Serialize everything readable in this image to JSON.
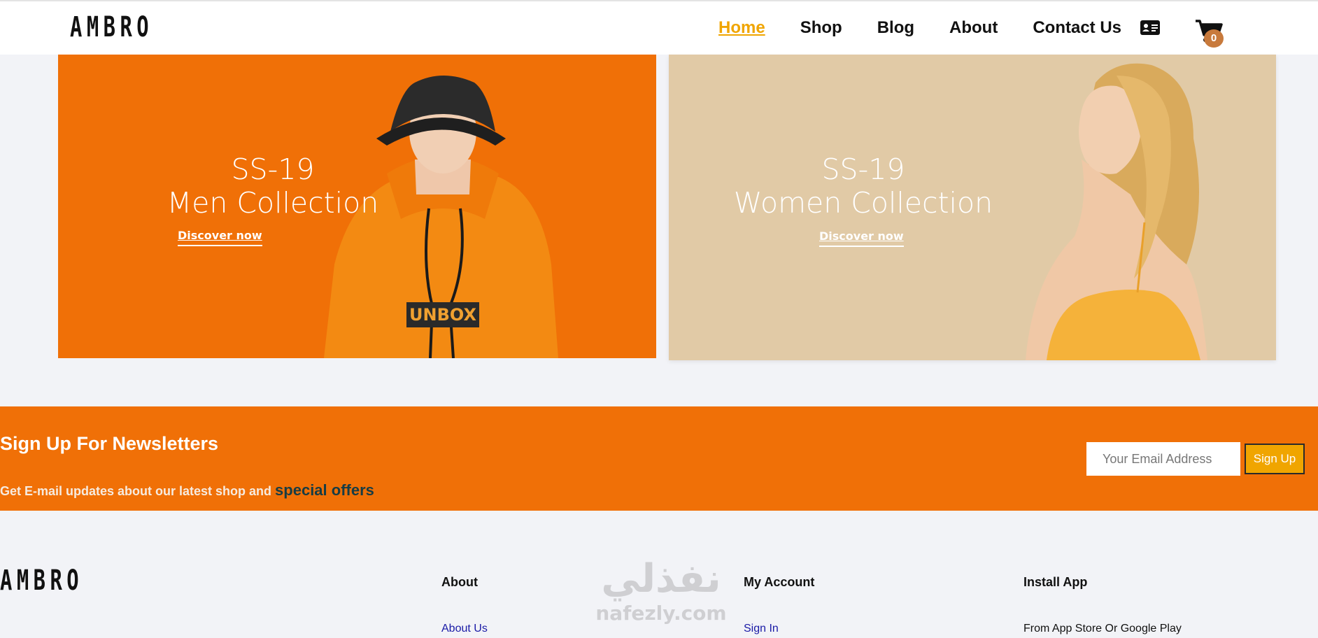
{
  "header": {
    "logo": "AMBRO",
    "nav": [
      "Home",
      "Shop",
      "Blog",
      "About",
      "Contact Us"
    ],
    "active_nav": "Home",
    "cart_count": "0"
  },
  "banners": {
    "men": {
      "line1": "SS-19",
      "line2": "Men Collection",
      "cta": "Discover now"
    },
    "women": {
      "line1": "SS-19",
      "line2": "Women Collection",
      "cta": "Discover now"
    }
  },
  "newsletter": {
    "title": "Sign Up For Newsletters",
    "text": "Get E-mail updates about our latest shop and ",
    "highlight": "special offers",
    "placeholder": "Your Email Address",
    "button": "Sign Up"
  },
  "footer": {
    "logo": "AMBRO",
    "about_title": "About",
    "about_link": "About Us",
    "account_title": "My Account",
    "account_link": "Sign In",
    "install_title": "Install App",
    "install_text": "From App Store Or Google Play"
  },
  "watermark": {
    "arabic": "نفذلي",
    "latin": "nafezly.com"
  },
  "colors": {
    "accent_orange": "#f07007",
    "nav_active": "#f0a500",
    "beige": "#e1caa6"
  }
}
